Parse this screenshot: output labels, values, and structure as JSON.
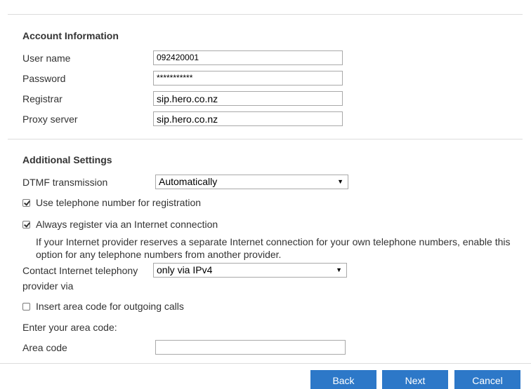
{
  "account": {
    "title": "Account Information",
    "username_label": "User name",
    "username_value": "092420001",
    "password_label": "Password",
    "password_value": "***********",
    "registrar_label": "Registrar",
    "registrar_value": "sip.hero.co.nz",
    "proxy_label": "Proxy server",
    "proxy_value": "sip.hero.co.nz"
  },
  "additional": {
    "title": "Additional Settings",
    "dtmf_label": "DTMF transmission",
    "dtmf_value": "Automatically",
    "use_phone_label": "Use telephone number for registration",
    "use_phone_checked": true,
    "always_register_label": "Always register via an Internet connection",
    "always_register_checked": true,
    "always_register_help": "If your Internet provider reserves a separate Internet connection for your own telephone numbers, enable this option for any telephone numbers from another provider.",
    "contact_label_line1": "Contact Internet telephony",
    "contact_label_line2": "provider via",
    "contact_value": "only via IPv4",
    "area_code_toggle_label": "Insert area code for outgoing calls",
    "area_code_toggle_checked": false,
    "enter_area_code_label": "Enter your area code:",
    "area_code_label": "Area code",
    "area_code_value": ""
  },
  "footer": {
    "back_label": "Back",
    "next_label": "Next",
    "cancel_label": "Cancel",
    "button_color": "#2d78c8"
  }
}
